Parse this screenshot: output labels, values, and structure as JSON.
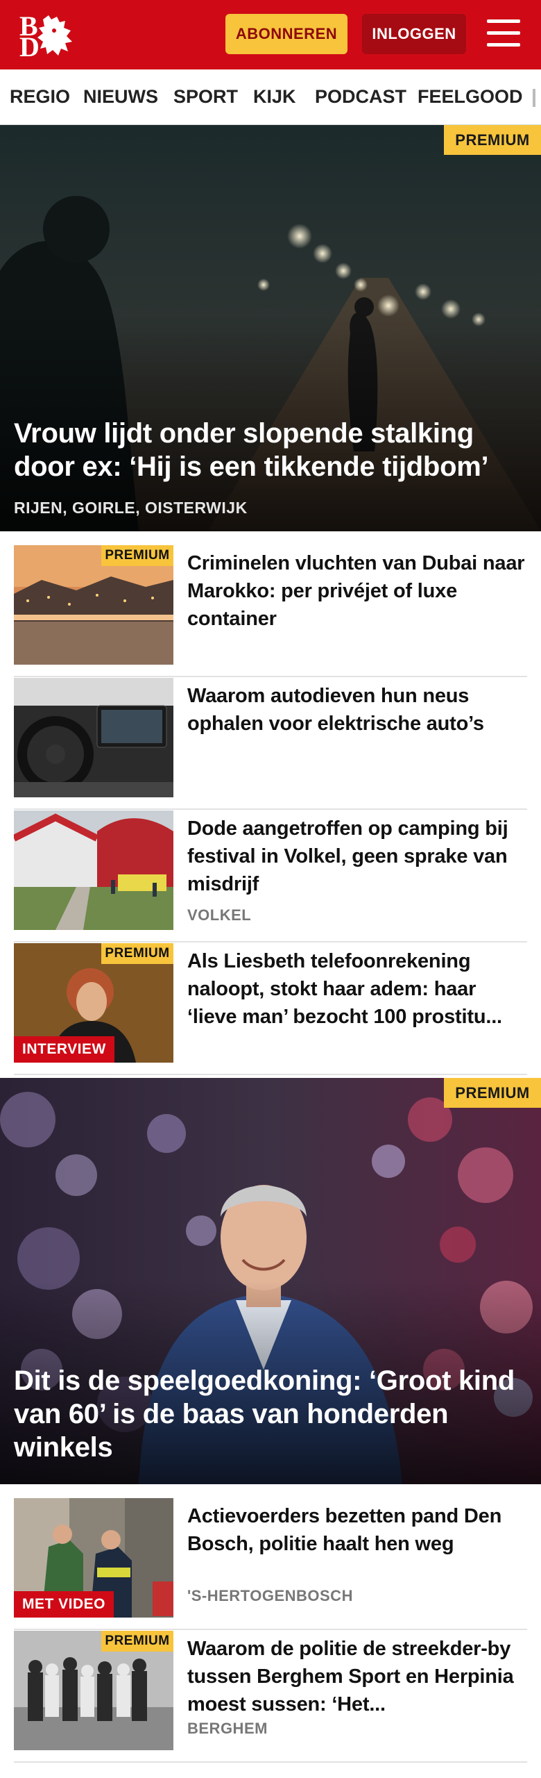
{
  "header": {
    "logo_top": "B",
    "logo_bottom": "D",
    "subscribe_label": "ABONNEREN",
    "login_label": "INLOGGEN",
    "menu_icon": "hamburger-menu-icon",
    "brand_color": "#cf0a16",
    "accent_color": "#f7c43c"
  },
  "nav": {
    "items": [
      "REGIO",
      "NIEUWS",
      "SPORT",
      "KIJK",
      "PODCAST",
      "FEELGOOD"
    ]
  },
  "hero1": {
    "badge": "PREMIUM",
    "title": "Vrouw lijdt onder slopende stalking door ex: ‘Hij is een tikkende tijdbom’",
    "location": "RIJEN, GOIRLE, OISTERWIJK"
  },
  "list1": [
    {
      "badge": "PREMIUM",
      "title": "Criminelen vluchten van Dubai naar Marokko: per privéjet of luxe container"
    },
    {
      "title": "Waarom autodieven hun neus ophalen voor elektrische auto’s"
    },
    {
      "title": "Dode aangetroffen op camping bij festival in Volkel, geen sprake van misdrijf",
      "location": "VOLKEL"
    },
    {
      "badge": "PREMIUM",
      "label": "INTERVIEW",
      "title": "Als Liesbeth telefoonrekening naloopt, stokt haar adem: haar ‘lieve man’ bezocht 100 prostitu..."
    }
  ],
  "hero2": {
    "badge": "PREMIUM",
    "title": "Dit is de speelgoedkoning: ‘Groot kind van 60’ is de baas van honderden winkels"
  },
  "list2": [
    {
      "label": "MET VIDEO",
      "title": "Actievoerders bezetten pand Den Bosch, politie haalt hen weg",
      "location": "'S-HERTOGENBOSCH"
    },
    {
      "badge": "PREMIUM",
      "title": "Waarom de politie de streekder-by tussen Berghem Sport en Herpinia moest sussen: ‘Het...",
      "location": "BERGHEM"
    }
  ]
}
